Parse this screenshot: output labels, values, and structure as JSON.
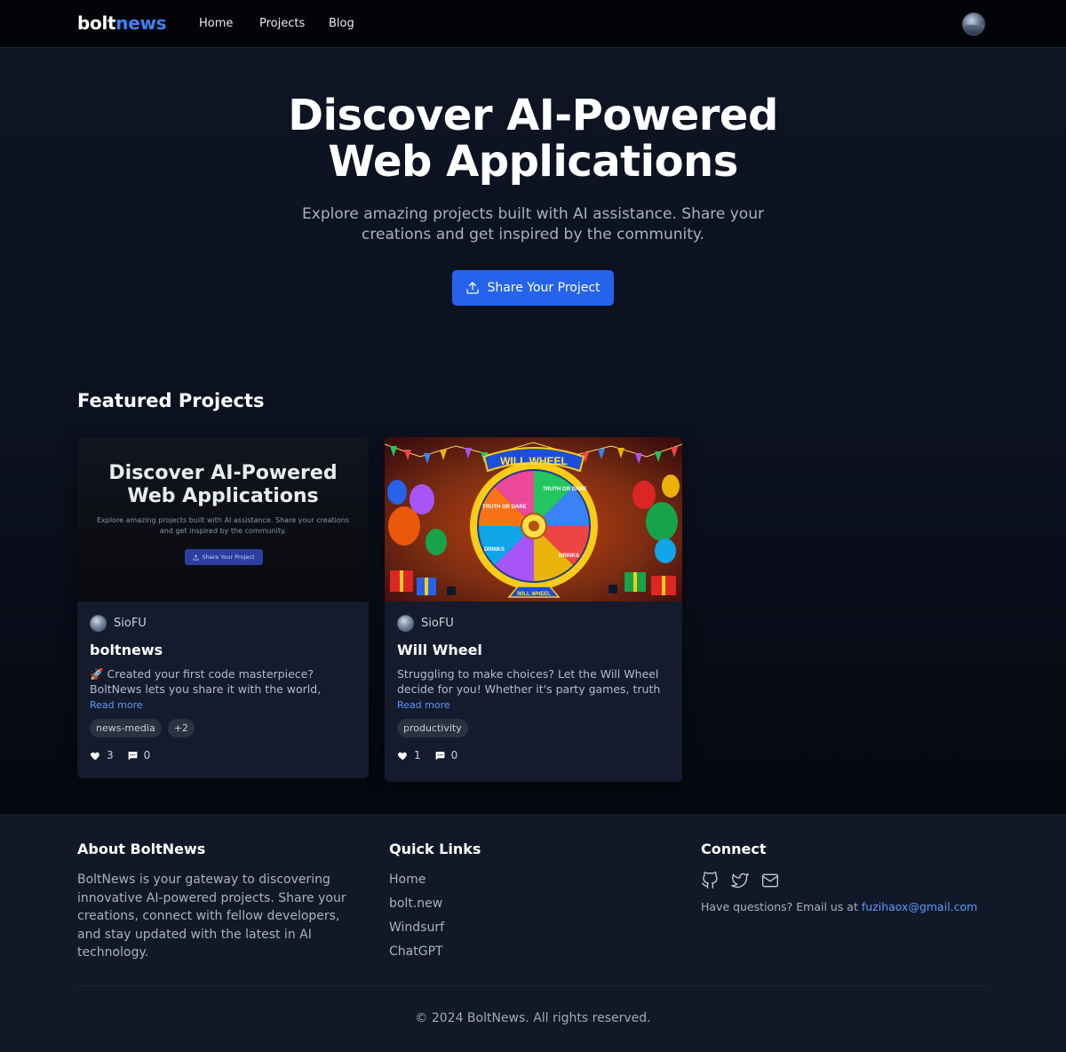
{
  "nav": {
    "brand_part1": "bolt",
    "brand_part2": "news",
    "links": [
      "Home",
      "Projects",
      "Blog"
    ],
    "avatar_icon": "user-avatar"
  },
  "hero": {
    "title_line1": "Discover AI-Powered",
    "title_line2": "Web Applications",
    "subtitle": "Explore amazing projects built with AI assistance. Share your creations and get inspired by the community.",
    "button_label": "Share Your Project",
    "button_icon": "upload-icon"
  },
  "featured": {
    "title": "Featured Projects",
    "projects": [
      {
        "thumb_title_line1": "Discover AI-Powered",
        "thumb_title_line2": "Web Applications",
        "thumb_sub": "Explore amazing projects built with AI assistance. Share your creations and get inspired by the community.",
        "thumb_button": "Share Your Project",
        "author": "SioFU",
        "title": "boltnews",
        "description": "🚀 Created your first code masterpiece? BoltNews lets you share it with the world, discover amazing...",
        "read_more": "Read more",
        "tags": [
          "news-media",
          "+2"
        ],
        "likes": "3",
        "comments": "0"
      },
      {
        "thumb_banner": "WILL WHEEL",
        "thumb_footer": "WILL WHEEL",
        "wheel_labels": [
          "TRUTH OR DARE",
          "DRINKS",
          "DRINKS",
          "TRUTH OR DARE"
        ],
        "author": "SioFU",
        "title": "Will Wheel",
        "description": "Struggling to make choices? Let the Will Wheel decide for you! Whether it's party games, truth or...",
        "read_more": "Read more",
        "tags": [
          "productivity"
        ],
        "likes": "1",
        "comments": "0"
      }
    ]
  },
  "footer": {
    "about_title": "About BoltNews",
    "about_text": "BoltNews is your gateway to discovering innovative AI-powered projects. Share your creations, connect with fellow developers, and stay updated with the latest in AI technology.",
    "links_title": "Quick Links",
    "links": [
      "Home",
      "bolt.new",
      "Windsurf",
      "ChatGPT"
    ],
    "connect_title": "Connect",
    "icons": [
      "github-icon",
      "twitter-icon",
      "mail-icon"
    ],
    "contact_prefix": "Have questions? Email us at ",
    "contact_email": "fuzihaox@gmail.com",
    "copyright": "© 2024 BoltNews. All rights reserved."
  },
  "colors": {
    "accent": "#2563eb",
    "link": "#5b9bff",
    "nav_bg": "#020407",
    "footer_bg": "#111827",
    "card_bg": "#141b2c"
  }
}
